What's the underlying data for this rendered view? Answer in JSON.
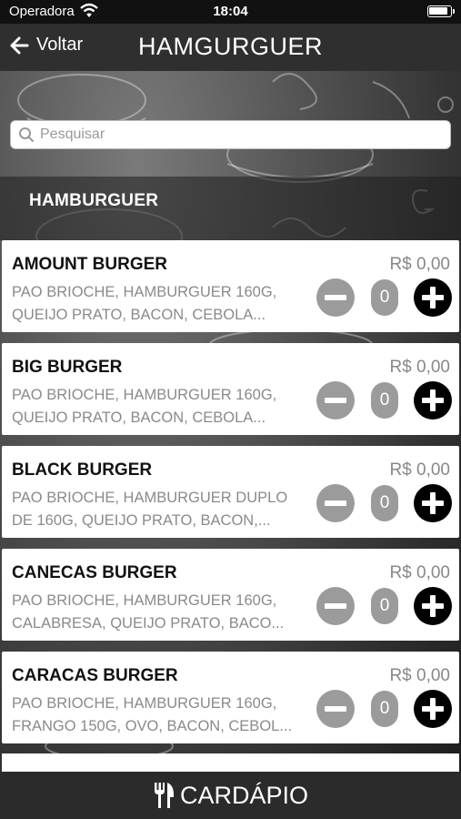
{
  "status_bar": {
    "carrier": "Operadora",
    "time": "18:04"
  },
  "nav": {
    "back_label": "Voltar",
    "title": "HAMGURGUER"
  },
  "search": {
    "placeholder": "Pesquisar"
  },
  "category": {
    "title": "HAMBURGUER"
  },
  "products": [
    {
      "name": "AMOUNT BURGER",
      "price": "R$ 0,00",
      "desc_line1": "PAO BRIOCHE, HAMBURGUER 160G,",
      "desc_line2": "QUEIJO PRATO, BACON, CEBOLA...",
      "quantity": "0"
    },
    {
      "name": "BIG BURGER",
      "price": "R$ 0,00",
      "desc_line1": "PAO BRIOCHE, HAMBURGUER 160G,",
      "desc_line2": "QUEIJO PRATO, BACON, CEBOLA...",
      "quantity": "0"
    },
    {
      "name": "BLACK BURGER",
      "price": "R$ 0,00",
      "desc_line1": "PAO BRIOCHE, HAMBURGUER DUPLO",
      "desc_line2": "DE 160G, QUEIJO PRATO, BACON,...",
      "quantity": "0"
    },
    {
      "name": "CANECAS BURGER",
      "price": "R$ 0,00",
      "desc_line1": "PAO BRIOCHE, HAMBURGUER 160G,",
      "desc_line2": "CALABRESA, QUEIJO PRATO, BACO...",
      "quantity": "0"
    },
    {
      "name": "CARACAS BURGER",
      "price": "R$ 0,00",
      "desc_line1": "PAO BRIOCHE, HAMBURGUER 160G,",
      "desc_line2": "FRANGO 150G, OVO, BACON, CEBOL...",
      "quantity": "0"
    }
  ],
  "bottom_bar": {
    "label": "CARDÁPIO"
  },
  "icons": [
    "wifi-icon",
    "battery-icon",
    "back-arrow-icon",
    "search-icon",
    "minus-icon",
    "plus-icon",
    "cutlery-icon"
  ],
  "colors": {
    "nav_background": "#2f2f2f",
    "plus_button": "#000000",
    "minus_button": "#9b9b9b",
    "price_text": "#888888"
  }
}
